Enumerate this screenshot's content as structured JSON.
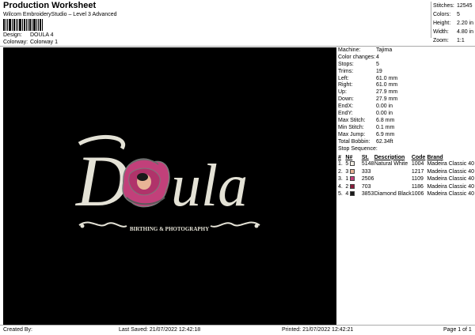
{
  "header": {
    "title": "Production Worksheet",
    "subtitle": "Wilcom EmbroideryStudio – Level 3 Advanced"
  },
  "meta": {
    "design_label": "Design:",
    "design_value": "DOULA 4",
    "colorway_label": "Colorway:",
    "colorway_value": "Colorway 1"
  },
  "stats": [
    {
      "label": "Stitches:",
      "value": "12545"
    },
    {
      "label": "Colors:",
      "value": "5"
    },
    {
      "label": "Height:",
      "value": "2.20 in"
    },
    {
      "label": "Width:",
      "value": "4.80 in"
    },
    {
      "label": "Zoom:",
      "value": "1:1"
    }
  ],
  "machine_info": [
    {
      "label": "Machine:",
      "value": "Tajima"
    },
    {
      "label": "Color changes:",
      "value": "4"
    },
    {
      "label": "Stops:",
      "value": "5"
    },
    {
      "label": "Trims:",
      "value": "19"
    },
    {
      "label": "Left:",
      "value": "61.0 mm"
    },
    {
      "label": "Right:",
      "value": "61.0 mm"
    },
    {
      "label": "Up:",
      "value": "27.9 mm"
    },
    {
      "label": "Down:",
      "value": "27.9 mm"
    },
    {
      "label": "EndX:",
      "value": "0.00 in"
    },
    {
      "label": "EndY:",
      "value": "0.00 in"
    },
    {
      "label": "Max Stitch:",
      "value": "6.8 mm"
    },
    {
      "label": "Min Stitch:",
      "value": "0.1 mm"
    },
    {
      "label": "Max Jump:",
      "value": "6.9 mm"
    },
    {
      "label": "Total Bobbin:",
      "value": "62.34ft"
    }
  ],
  "stop_sequence": {
    "title": "Stop Sequence:",
    "headers": [
      "#",
      "N#",
      "St.",
      "Description",
      "Code",
      "Brand"
    ],
    "rows": [
      {
        "num": "1.",
        "n": "5",
        "st": "5148",
        "desc": "Natural White",
        "code": "1004",
        "brand": "Madeira Classic 40",
        "color": "#f2eee4"
      },
      {
        "num": "2.",
        "n": "3",
        "st": "333",
        "desc": "",
        "code": "1217",
        "brand": "Madeira Classic 40",
        "color": "#e8b496"
      },
      {
        "num": "3.",
        "n": "1",
        "st": "2506",
        "desc": "",
        "code": "1109",
        "brand": "Madeira Classic 40",
        "color": "#c2407a"
      },
      {
        "num": "4.",
        "n": "2",
        "st": "703",
        "desc": "",
        "code": "1186",
        "brand": "Madeira Classic 40",
        "color": "#8c1d3c"
      },
      {
        "num": "5.",
        "n": "4",
        "st": "3853",
        "desc": "Diamond Black",
        "code": "1006",
        "brand": "Madeira Classic 40",
        "color": "#1a1a1a"
      }
    ]
  },
  "design": {
    "text_d": "D",
    "text_rest": "ula",
    "tagline": "BIRTHING & PHOTOGRAPHY",
    "thread_white": "#e4e2d6",
    "rose_pink": "#c2407a",
    "rose_dark": "#8c1d3c",
    "skin": "#e8b496"
  },
  "footer": {
    "created": "Created By:",
    "last_saved": "Last Saved: 21/07/2022 12:42:18",
    "printed": "Printed: 21/07/2022 12:42:21",
    "page": "Page 1 of 1"
  }
}
